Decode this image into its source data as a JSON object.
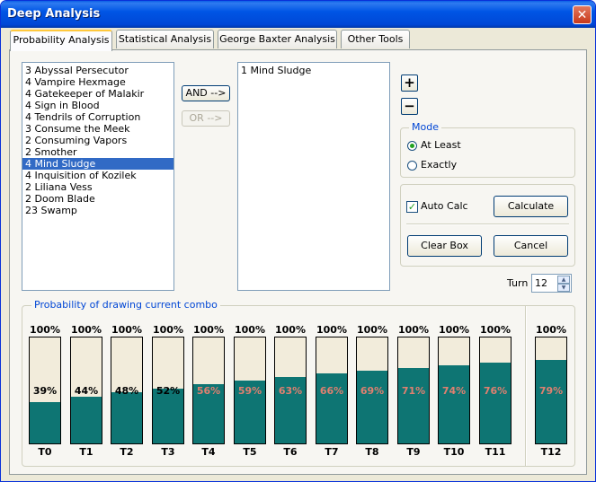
{
  "window": {
    "title": "Deep Analysis",
    "close_glyph": "✕"
  },
  "tabs": [
    {
      "label": "Probability Analysis",
      "active": true
    },
    {
      "label": "Statistical Analysis",
      "active": false
    },
    {
      "label": "George Baxter Analysis",
      "active": false
    },
    {
      "label": "Other Tools",
      "active": false
    }
  ],
  "card_list": {
    "items": [
      "3 Abyssal Persecutor",
      "4 Vampire Hexmage",
      "4 Gatekeeper of Malakir",
      "4 Sign in Blood",
      "4 Tendrils of Corruption",
      "3 Consume the Meek",
      "2 Consuming Vapors",
      "2 Smother",
      "4 Mind Sludge",
      "4 Inquisition of Kozilek",
      "2 Liliana Vess",
      "2 Doom Blade",
      "23 Swamp"
    ],
    "selected_index": 8
  },
  "combo_buttons": {
    "and_label": "AND -->",
    "or_label": "OR -->"
  },
  "combo_list": {
    "items": [
      "1 Mind Sludge"
    ]
  },
  "plus_minus": {
    "plus": "+",
    "minus": "−"
  },
  "mode": {
    "label": "Mode",
    "options": [
      {
        "label": "At Least",
        "checked": true
      },
      {
        "label": "Exactly",
        "checked": false
      }
    ]
  },
  "controls": {
    "auto_calc_label": "Auto Calc",
    "auto_calc_checked": true,
    "calculate_label": "Calculate",
    "clear_box_label": "Clear Box",
    "cancel_label": "Cancel"
  },
  "turn": {
    "label": "Turn",
    "value": "12"
  },
  "probability": {
    "group_label": "Probability of drawing current combo",
    "colors": {
      "fill": "#0e7573",
      "empty": "#f2ecdb",
      "pct_dark": "#000000",
      "pct_light": "#e08070"
    },
    "bars": [
      {
        "turn": "T0",
        "top": "100%",
        "pct": "39%",
        "value": 0.39
      },
      {
        "turn": "T1",
        "top": "100%",
        "pct": "44%",
        "value": 0.44
      },
      {
        "turn": "T2",
        "top": "100%",
        "pct": "48%",
        "value": 0.48
      },
      {
        "turn": "T3",
        "top": "100%",
        "pct": "52%",
        "value": 0.52
      },
      {
        "turn": "T4",
        "top": "100%",
        "pct": "56%",
        "value": 0.56
      },
      {
        "turn": "T5",
        "top": "100%",
        "pct": "59%",
        "value": 0.59
      },
      {
        "turn": "T6",
        "top": "100%",
        "pct": "63%",
        "value": 0.63
      },
      {
        "turn": "T7",
        "top": "100%",
        "pct": "66%",
        "value": 0.66
      },
      {
        "turn": "T8",
        "top": "100%",
        "pct": "69%",
        "value": 0.69
      },
      {
        "turn": "T9",
        "top": "100%",
        "pct": "71%",
        "value": 0.71
      },
      {
        "turn": "T10",
        "top": "100%",
        "pct": "74%",
        "value": 0.74
      },
      {
        "turn": "T11",
        "top": "100%",
        "pct": "76%",
        "value": 0.76
      },
      {
        "turn": "T12",
        "top": "100%",
        "pct": "79%",
        "value": 0.79
      }
    ]
  }
}
